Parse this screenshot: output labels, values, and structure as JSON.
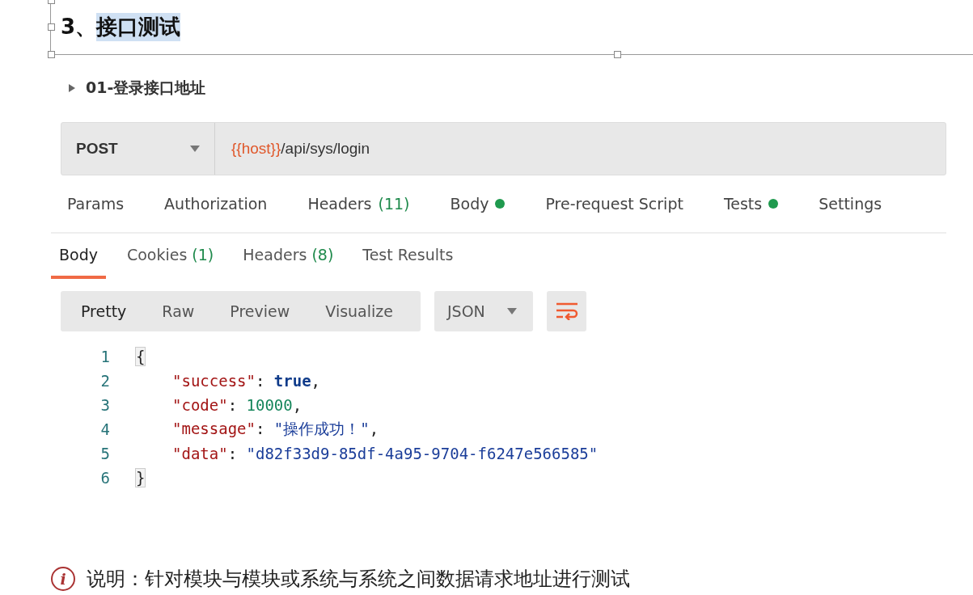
{
  "heading": {
    "number": "3、",
    "title": "接口测试",
    "highlighted": true
  },
  "request": {
    "name": "01-登录接口地址",
    "method": "POST",
    "url_variable": "{{host}}",
    "url_path": "/api/sys/login"
  },
  "request_tabs": [
    {
      "label": "Params",
      "dot": false
    },
    {
      "label": "Authorization",
      "dot": false
    },
    {
      "label": "Headers",
      "count": "(11)",
      "dot": false
    },
    {
      "label": "Body",
      "dot": true
    },
    {
      "label": "Pre-request Script",
      "dot": false
    },
    {
      "label": "Tests",
      "dot": true
    },
    {
      "label": "Settings",
      "dot": false
    }
  ],
  "response_tabs": [
    {
      "label": "Body",
      "selected": true
    },
    {
      "label": "Cookies",
      "count": "(1)",
      "selected": false
    },
    {
      "label": "Headers",
      "count": "(8)",
      "selected": false
    },
    {
      "label": "Test Results",
      "selected": false
    }
  ],
  "view_modes": [
    {
      "label": "Pretty",
      "selected": true
    },
    {
      "label": "Raw",
      "selected": false
    },
    {
      "label": "Preview",
      "selected": false
    },
    {
      "label": "Visualize",
      "selected": false
    }
  ],
  "format": "JSON",
  "code_lines": [
    {
      "number": "1",
      "indented": false,
      "tokens": [
        {
          "kind": "brace",
          "text": "{"
        }
      ]
    },
    {
      "number": "2",
      "indented": true,
      "tokens": [
        {
          "kind": "key",
          "text": "\"success\""
        },
        {
          "kind": "punct",
          "text": ": "
        },
        {
          "kind": "bool",
          "text": "true"
        },
        {
          "kind": "punct",
          "text": ","
        }
      ]
    },
    {
      "number": "3",
      "indented": true,
      "tokens": [
        {
          "kind": "key",
          "text": "\"code\""
        },
        {
          "kind": "punct",
          "text": ": "
        },
        {
          "kind": "number",
          "text": "10000"
        },
        {
          "kind": "punct",
          "text": ","
        }
      ]
    },
    {
      "number": "4",
      "indented": true,
      "tokens": [
        {
          "kind": "key",
          "text": "\"message\""
        },
        {
          "kind": "punct",
          "text": ": "
        },
        {
          "kind": "string",
          "text": "\"操作成功！\""
        },
        {
          "kind": "punct",
          "text": ","
        }
      ]
    },
    {
      "number": "5",
      "indented": true,
      "tokens": [
        {
          "kind": "key",
          "text": "\"data\""
        },
        {
          "kind": "punct",
          "text": ": "
        },
        {
          "kind": "string",
          "text": "\"d82f33d9-85df-4a95-9704-f6247e566585\""
        }
      ]
    },
    {
      "number": "6",
      "indented": false,
      "tokens": [
        {
          "kind": "brace",
          "text": "}"
        }
      ]
    }
  ],
  "note": {
    "icon": "i",
    "text": "说明：针对模块与模块或系统与系统之间数据请求地址进行测试"
  }
}
